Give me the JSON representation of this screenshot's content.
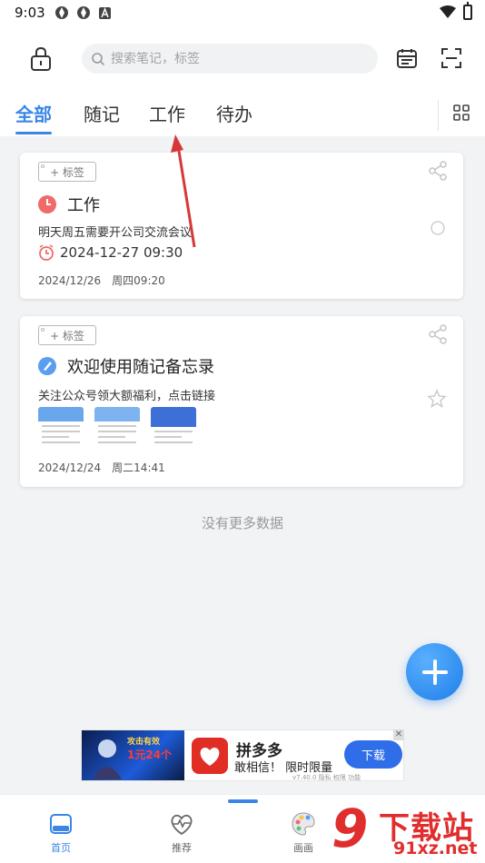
{
  "status_bar": {
    "time": "9:03"
  },
  "search": {
    "placeholder": "搜索笔记，标签"
  },
  "tabs": [
    {
      "label": "全部",
      "active": true
    },
    {
      "label": "随记"
    },
    {
      "label": "工作"
    },
    {
      "label": "待办"
    }
  ],
  "notes": [
    {
      "tag_button": "+ 标签",
      "title": "工作",
      "content": "明天周五需要开公司交流会议",
      "reminder": "2024-12-27 09:30",
      "created": "2024/12/26",
      "created_time": "周四09:20",
      "icon": "clock-icon",
      "accent": "#f06a6a"
    },
    {
      "tag_button": "+ 标签",
      "title": "欢迎使用随记备忘录",
      "content": "关注公众号领大额福利，点击链接",
      "created": "2024/12/24",
      "created_time": "周二14:41",
      "icon": "pen-icon",
      "accent": "#5b9ef0"
    }
  ],
  "list_end": "没有更多数据",
  "ad": {
    "game_line1": "攻击有效",
    "game_line2": "1元24个",
    "brand": "拼多多",
    "slogan": "敢相信！ 限时限量",
    "button": "下载",
    "meta": "v7.40.0  隐私  权限  功能"
  },
  "bottom_nav": [
    {
      "label": "首页",
      "active": true,
      "icon": "home-icon"
    },
    {
      "label": "推荐",
      "icon": "heart-pulse-icon"
    },
    {
      "label": "画画",
      "icon": "palette-icon"
    }
  ],
  "watermark": {
    "main": "下载站",
    "sub": "91xz.net",
    "digit": "9"
  },
  "colors": {
    "accent": "#3b86e5",
    "red": "#f06a6a"
  }
}
